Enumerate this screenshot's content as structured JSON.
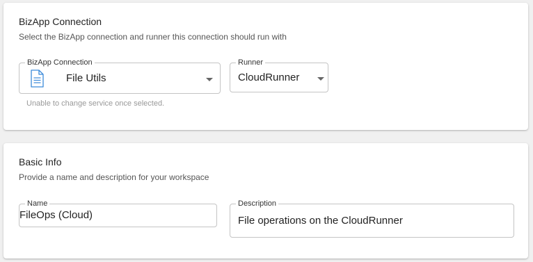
{
  "bizapp_section": {
    "title": "BizApp Connection",
    "subtitle": "Select the BizApp connection and runner this connection should run with",
    "connection_field": {
      "label": "BizApp Connection",
      "value": "File Utils",
      "icon": "document-icon",
      "helper": "Unable to change service once selected."
    },
    "runner_field": {
      "label": "Runner",
      "value": "CloudRunner"
    }
  },
  "basic_info_section": {
    "title": "Basic Info",
    "subtitle": "Provide a name and description for your workspace",
    "name_field": {
      "label": "Name",
      "value": "FileOps (Cloud)"
    },
    "description_field": {
      "label": "Description",
      "value": "File operations on the CloudRunner"
    }
  },
  "colors": {
    "page_background": "#f0f0f0",
    "card_background": "#ffffff",
    "border": "#c4c4c4",
    "icon_blue": "#3b8ad9"
  }
}
